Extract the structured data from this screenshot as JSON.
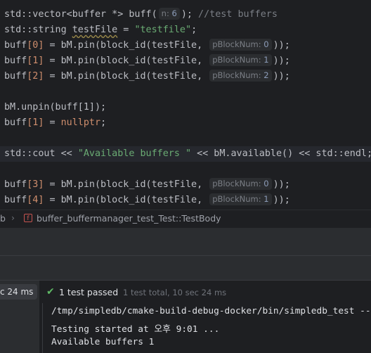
{
  "editor": {
    "lines": [
      {
        "t1": "std::vector<buffer *> buff(",
        "hint_name": "n:",
        "hint_val": "6",
        "t2": "); ",
        "comment": "//test buffers"
      },
      {
        "t1": "std::string ",
        "var": "testFile",
        "t2": " = ",
        "str": "\"testfile\"",
        "t3": ";"
      },
      {
        "t1": "buff",
        "idx": "[0]",
        "t2": " = bM.pin(block_id(testFile, ",
        "hint_name": "pBlockNum:",
        "hint_val": "0",
        "t3": "));"
      },
      {
        "t1": "buff",
        "idx": "[1]",
        "t2": " = bM.pin(block_id(testFile, ",
        "hint_name": "pBlockNum:",
        "hint_val": "1",
        "t3": "));"
      },
      {
        "t1": "buff",
        "idx": "[2]",
        "t2": " = bM.pin(block_id(testFile, ",
        "hint_name": "pBlockNum:",
        "hint_val": "2",
        "t3": "));"
      },
      {
        "t1": "bM.unpin(buff[1]);"
      },
      {
        "t1": "buff",
        "idx": "[1]",
        "t2": " = ",
        "kw": "nullptr",
        "t3": ";"
      },
      {
        "t1": "std::cout << ",
        "str": "\"Available buffers \"",
        "t2": " << bM.available() << std::endl;"
      },
      {
        "t1": "buff",
        "idx": "[3]",
        "t2": " = bM.pin(block_id(testFile, ",
        "hint_name": "pBlockNum:",
        "hint_val": "0",
        "t3": "));"
      },
      {
        "t1": "buff",
        "idx": "[4]",
        "t2": " = bM.pin(block_id(testFile, ",
        "hint_name": "pBlockNum:",
        "hint_val": "1",
        "t3": "));"
      }
    ]
  },
  "breadcrumb": {
    "prefix": "b",
    "chevron": "›",
    "func_icon": "f",
    "text": "buffer_buffermanager_test_Test::TestBody"
  },
  "run": {
    "time_pill": "c 24 ms",
    "check_icon": "checkmark-icon",
    "passed": "1 test passed",
    "total": "1 test total, 10 sec 24 ms",
    "console": [
      "/tmp/simpledb/cmake-build-debug-docker/bin/simpledb_test --",
      "Testing started at 오후 9:01 ...",
      "Available buffers 1"
    ]
  },
  "colors": {
    "background": "#1e1f22",
    "keyword": "#cf8e6d",
    "string": "#6aab73",
    "number": "#2aacb8",
    "comment": "#7a7e85",
    "success": "#5fb865"
  }
}
